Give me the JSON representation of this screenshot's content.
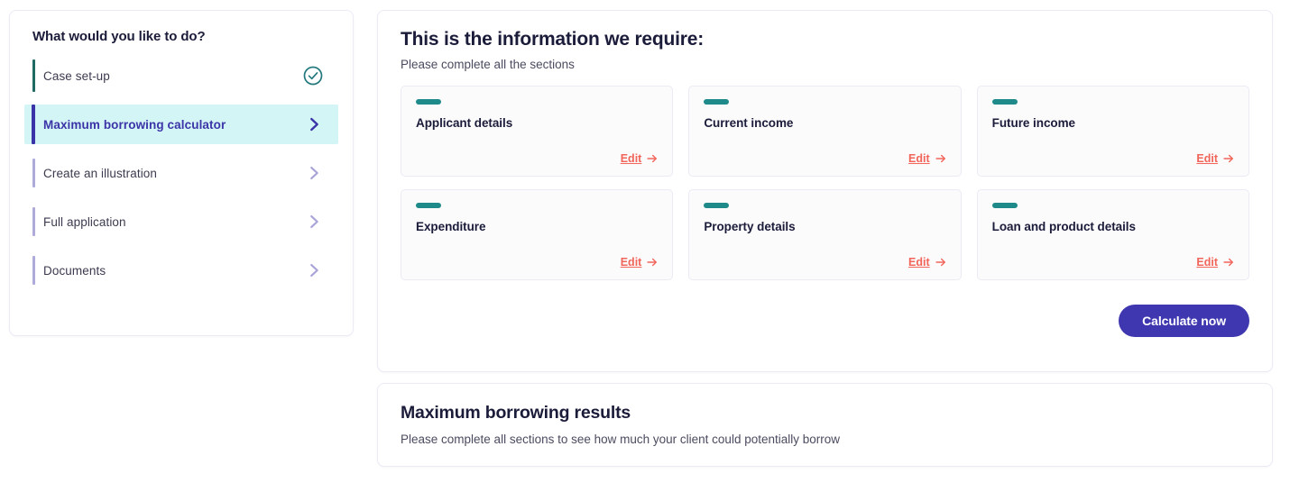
{
  "sidebar": {
    "title": "What would you like to do?",
    "items": [
      {
        "label": "Case set-up",
        "state": "done",
        "icon": "check-circle-icon"
      },
      {
        "label": "Maximum borrowing calculator",
        "state": "active",
        "icon": "chevron-right-icon"
      },
      {
        "label": "Create an illustration",
        "state": "default",
        "icon": "chevron-right-icon"
      },
      {
        "label": "Full application",
        "state": "default",
        "icon": "chevron-right-icon"
      },
      {
        "label": "Documents",
        "state": "default",
        "icon": "chevron-right-icon"
      }
    ]
  },
  "main": {
    "title": "This is the information we require:",
    "subtitle": "Please complete all the sections",
    "cards": [
      {
        "name": "Applicant details",
        "edit_label": "Edit"
      },
      {
        "name": "Current income",
        "edit_label": "Edit"
      },
      {
        "name": "Future income",
        "edit_label": "Edit"
      },
      {
        "name": "Expenditure",
        "edit_label": "Edit"
      },
      {
        "name": "Property details",
        "edit_label": "Edit"
      },
      {
        "name": "Loan and product details",
        "edit_label": "Edit"
      }
    ],
    "calculate_label": "Calculate now"
  },
  "results": {
    "title": "Maximum borrowing results",
    "subtitle": "Please complete all sections to see how much your client could potentially borrow"
  },
  "colors": {
    "accent_indigo": "#3f37b0",
    "accent_teal": "#1f8a8a",
    "accent_coral": "#f1655a",
    "active_bg": "#d4f5f5",
    "done_bar": "#1f6b63",
    "idle_bar": "#aeaada",
    "text_dark": "#1b1b3a"
  }
}
